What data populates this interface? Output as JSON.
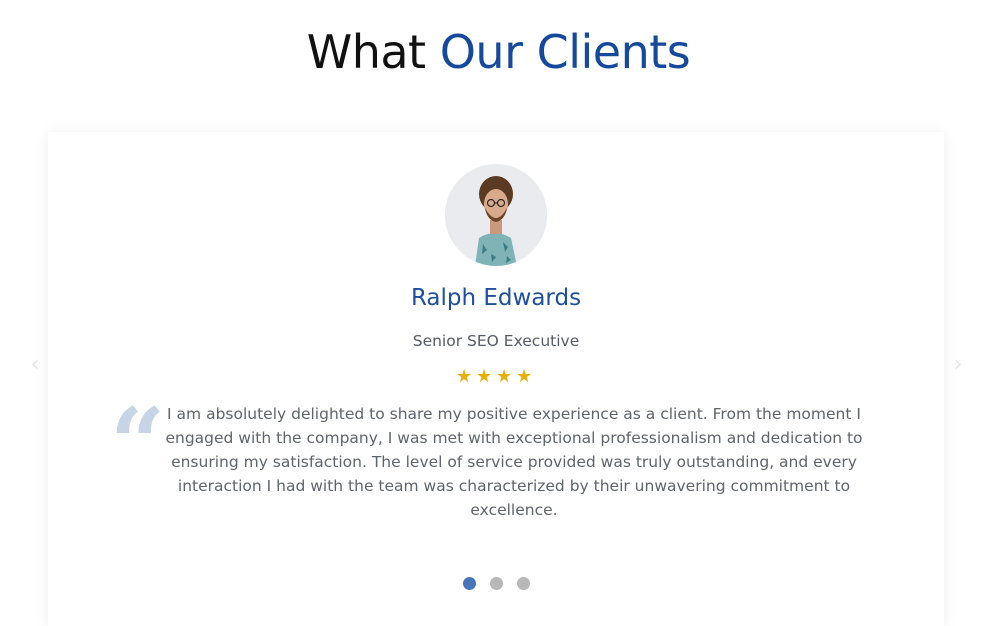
{
  "section": {
    "heading_part1": "What",
    "heading_part2": "Our Clients"
  },
  "testimonial": {
    "name": "Ralph Edwards",
    "role": "Senior SEO Executive",
    "rating": 4,
    "star_glyph": "★",
    "text": "I am absolutely delighted to share my positive experience as a client. From the moment I engaged with the company, I was met with exceptional professionalism and dedication to ensuring my satisfaction. The level of service provided was truly outstanding, and every interaction I had with the team was characterized by their unwavering commitment to excellence."
  },
  "carousel": {
    "slides": 3,
    "active_index": 0
  },
  "colors": {
    "heading_blue": "#15499b",
    "name_blue": "#1d4f9c",
    "star": "#e8b007",
    "quote_mark": "#c7d4e5",
    "dot_active": "#4a74ba",
    "dot_inactive": "#b7b7b7"
  },
  "icons": {
    "quote": "quote-icon",
    "star": "star-icon",
    "prev": "chevron-left-icon",
    "next": "chevron-right-icon"
  }
}
